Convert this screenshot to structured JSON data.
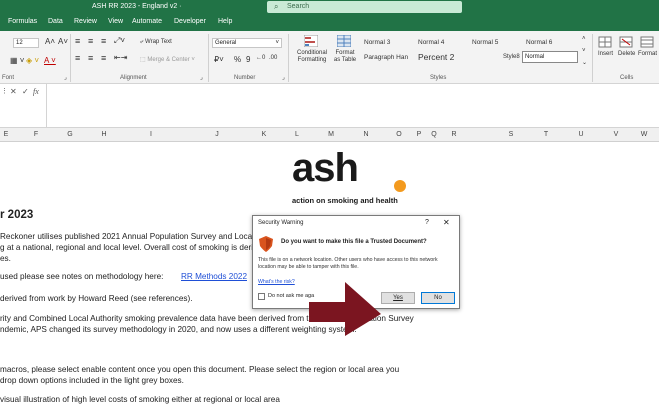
{
  "window": {
    "title": "ASH RR 2023 - England v2 ·",
    "search_placeholder": "Search"
  },
  "menu": [
    "Formulas",
    "Data",
    "Review",
    "View",
    "Automate",
    "Developer",
    "Help"
  ],
  "ribbon": {
    "font_size": "12",
    "font_group": "Font",
    "alignment_group": "Alignment",
    "wrap_text": "Wrap Text",
    "merge_center": "Merge & Center",
    "number_format": "General",
    "number_group": "Number",
    "conditional_formatting": "Conditional Formatting",
    "format_as_table": "Format as Table",
    "styles": [
      "Normal 3",
      "Normal 4",
      "Normal 5",
      "Normal 6",
      "Paragraph Han",
      "Percent 2",
      "Style8",
      "Normal"
    ],
    "styles_group": "Styles",
    "insert": "Insert",
    "delete": "Delete",
    "format": "Format",
    "cells_group": "Cells"
  },
  "formula_bar": {
    "fx": "fx"
  },
  "columns": [
    "E",
    "F",
    "G",
    "H",
    "I",
    "J",
    "K",
    "L",
    "M",
    "N",
    "O",
    "P",
    "Q",
    "R",
    "S",
    "T",
    "U",
    "V",
    "W"
  ],
  "sheet": {
    "logo_word": "ash",
    "logo_tagline": "action on smoking and health",
    "heading": "r 2023",
    "lines": [
      "Reckoner utilises published 2021 Annual Population Survey and Local T",
      "g at a national, regional and local level. Overall cost of smoking is deriv",
      "es.",
      "used please see notes on methodology here:",
      "derived from work by Howard Reed (see references).",
      "rity and Combined Local Authority smoking prevalence data have been derived from the Annual Population Survey",
      "ndemic, APS changed its survey methodology in 2020, and now uses a different weighting system.",
      "macros, please select enable content once you open this document. Please select the region or local area you",
      "drop down options included in the light grey boxes.",
      "visual illustration of high level costs of smoking either at regional or local area"
    ],
    "link_text": "RR Methods 2022"
  },
  "dialog": {
    "title": "Security Warning",
    "help": "?",
    "close": "✕",
    "question": "Do you want to make this file a Trusted Document?",
    "body": "This file is on a network location. Other users who have access to this network location may be able to tamper with this file.",
    "risk_link": "What's the risk?",
    "checkbox_label": "Do not ask me aga",
    "yes": "Yes",
    "no": "No"
  },
  "colors": {
    "excel_green": "#217346",
    "arrow": "#7b1520",
    "shield": "#d9541e"
  }
}
